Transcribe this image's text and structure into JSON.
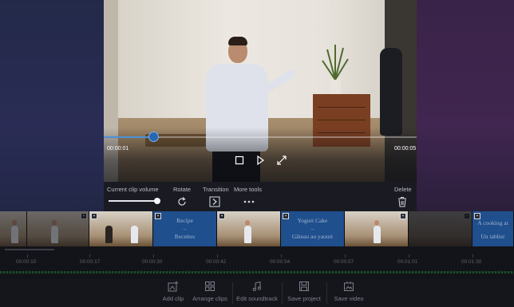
{
  "preview": {
    "current_time": "00:00:01",
    "total_time": "00:00:05",
    "progress_fraction": 0.16
  },
  "clip_controls": {
    "volume_label": "Current clip volume",
    "volume_fraction": 1.0,
    "rotate_label": "Rotate",
    "transition_label": "Transition",
    "more_tools_label": "More tools",
    "delete_label": "Delete"
  },
  "storyboard": {
    "clips": [
      {
        "kind": "photo"
      },
      {
        "kind": "photo"
      },
      {
        "kind": "photo"
      },
      {
        "kind": "card",
        "line1": "Recipe",
        "line2": "–",
        "line3": "Recettes"
      },
      {
        "kind": "photo"
      },
      {
        "kind": "card",
        "line1": "Yogurt Cake",
        "line2": "–",
        "line3": "Gâteau au yaourt"
      },
      {
        "kind": "photo"
      },
      {
        "kind": "card",
        "line1": "A cooking at",
        "line2": "",
        "line3": "Un tablier"
      }
    ]
  },
  "timeline": {
    "labels": [
      "00:00:10",
      "00:00:17",
      "00:00:30",
      "00:00:42",
      "00:00:54",
      "00:00:57",
      "00:01:01",
      "00:01:30"
    ]
  },
  "toolbar": {
    "add_clip": "Add clip",
    "arrange_clips": "Arrange clips",
    "edit_soundtrack": "Edit soundtrack",
    "save_project": "Save project",
    "save_video": "Save video"
  },
  "colors": {
    "accent": "#4a90d9",
    "card_blue": "#1f4f8c"
  }
}
